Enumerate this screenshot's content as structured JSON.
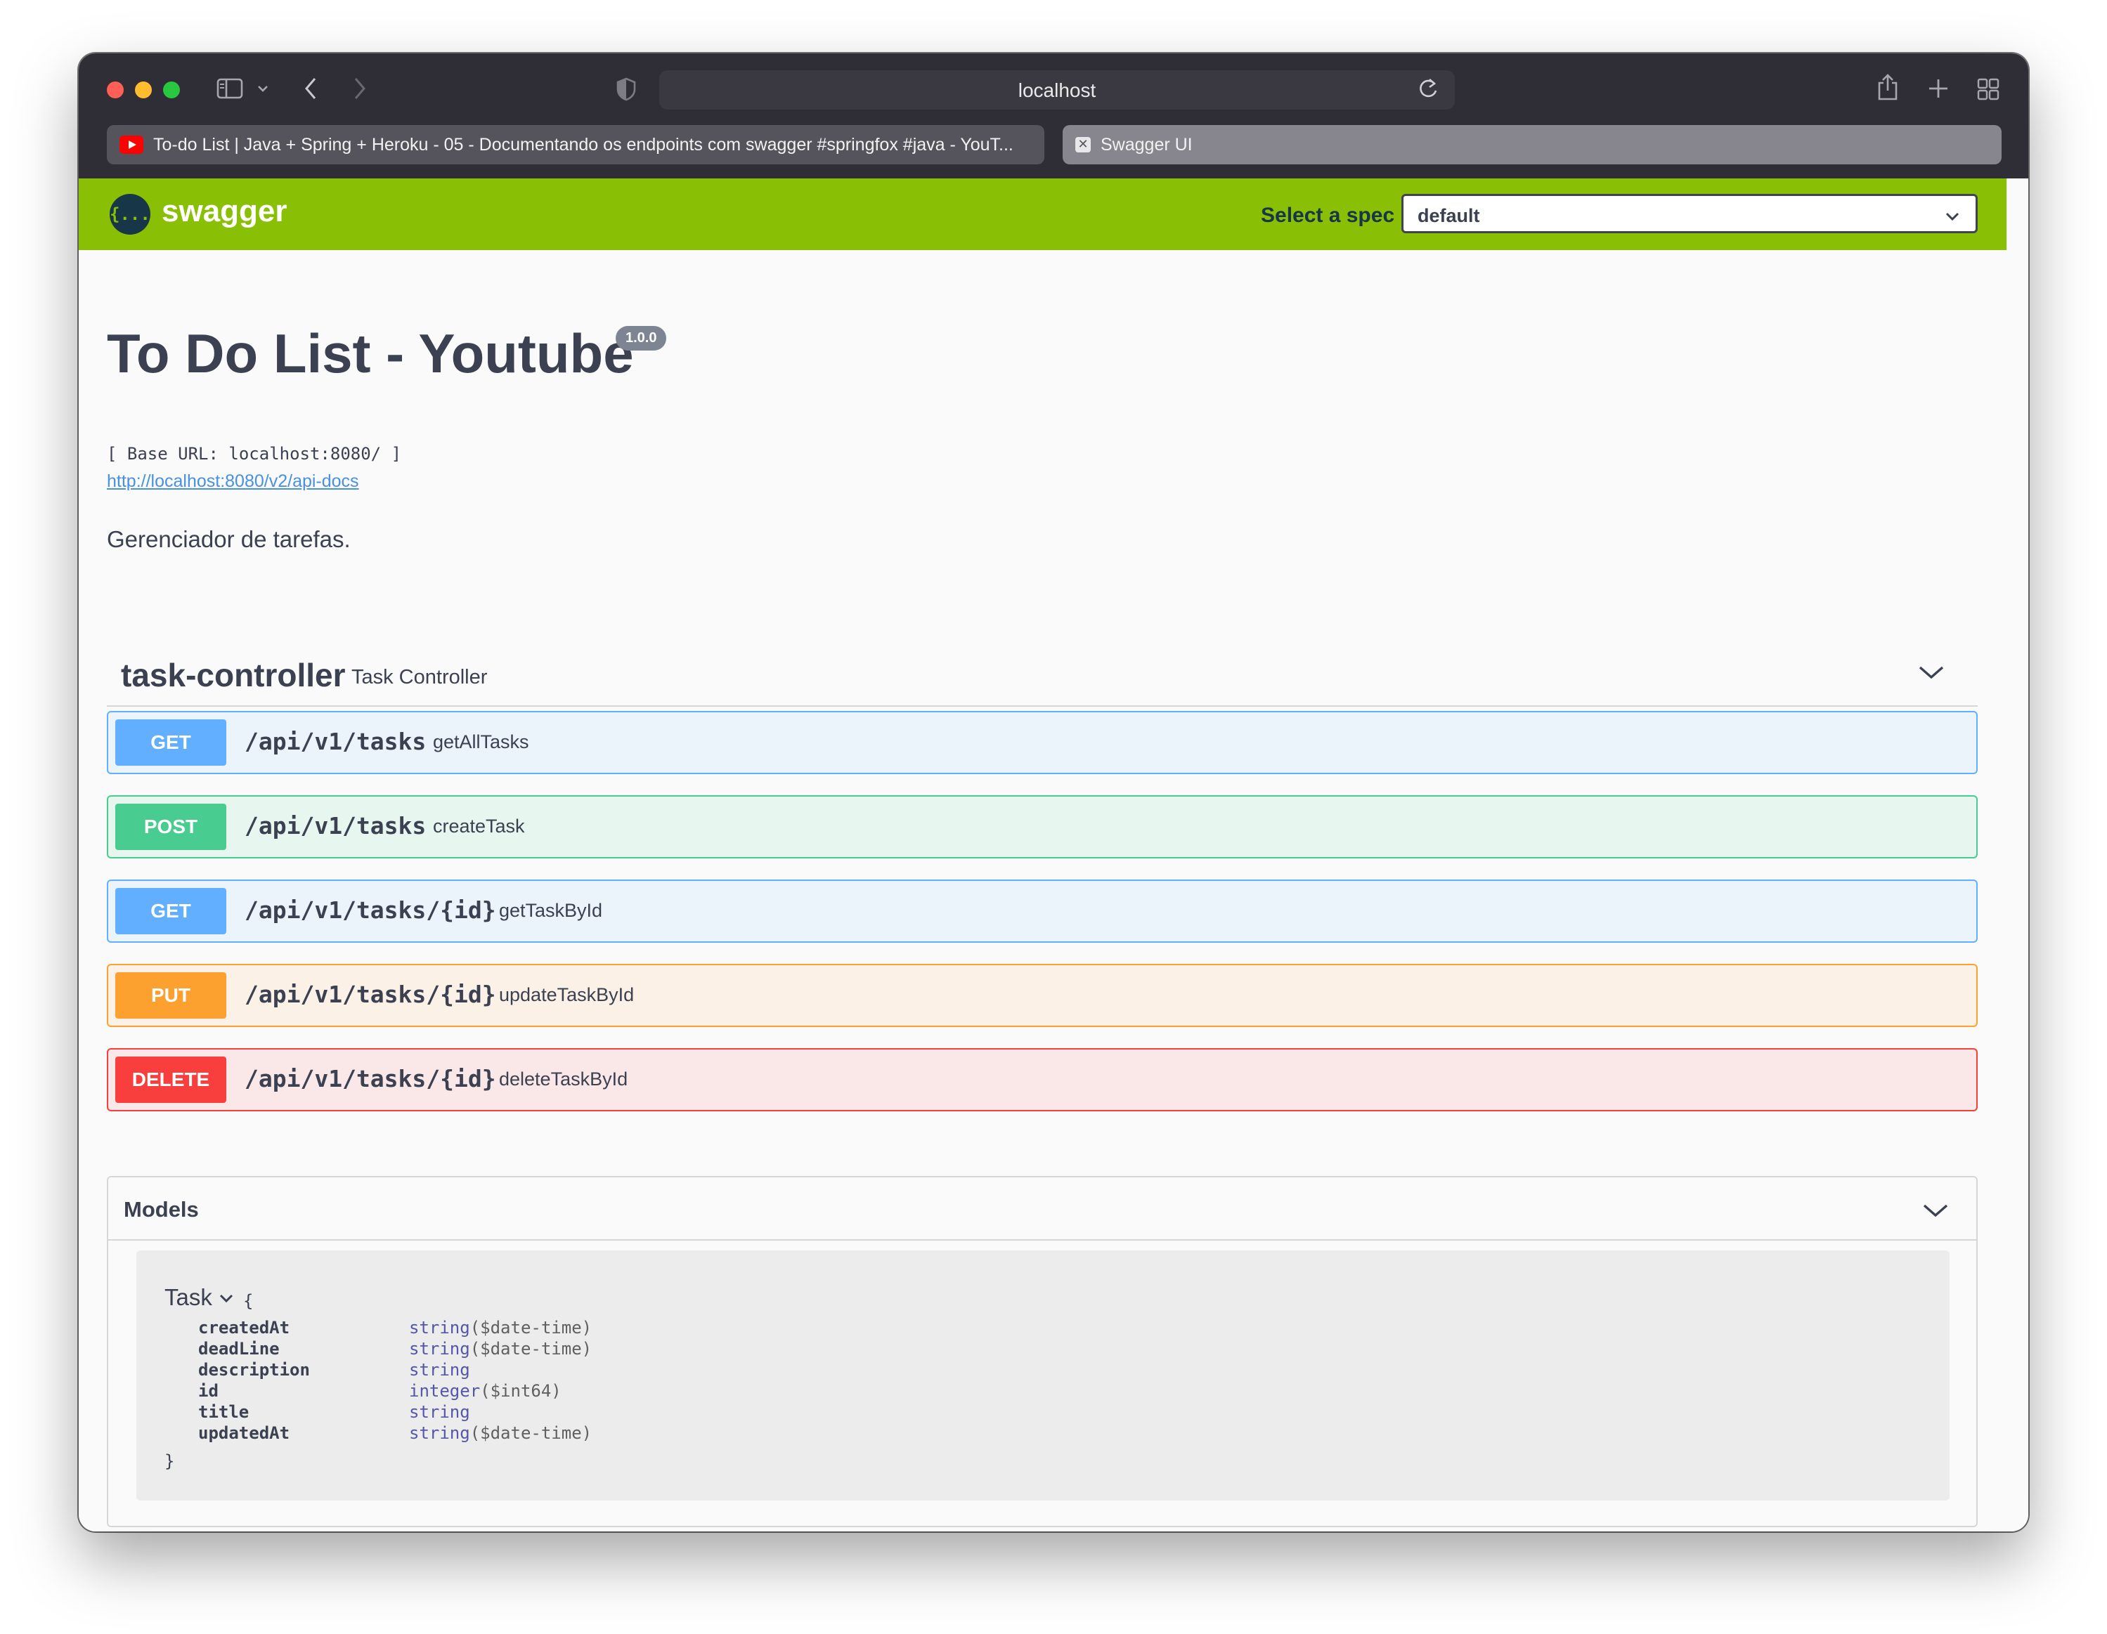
{
  "browser": {
    "url": "localhost",
    "tabs": [
      {
        "title": "To-do List | Java + Spring + Heroku - 05 - Documentando os endpoints com swagger #springfox #java - YouT..."
      },
      {
        "title": "Swagger UI"
      }
    ]
  },
  "topbar": {
    "logo_text": "swagger",
    "logo_glyph": "{...}",
    "spec_label": "Select a spec",
    "spec_value": "default",
    "bar_color": "#89bf04"
  },
  "info": {
    "title": "To Do List - Youtube",
    "version": "1.0.0",
    "base_url": "[ Base URL: localhost:8080/ ]",
    "api_docs_link": "http://localhost:8080/v2/api-docs",
    "description": "Gerenciador de tarefas."
  },
  "tag": {
    "name": "task-controller",
    "description": "Task Controller"
  },
  "operations": [
    {
      "method": "GET",
      "path": "/api/v1/tasks",
      "summary": "getAllTasks",
      "color": "#61affe"
    },
    {
      "method": "POST",
      "path": "/api/v1/tasks",
      "summary": "createTask",
      "color": "#49cc90"
    },
    {
      "method": "GET",
      "path": "/api/v1/tasks/{id}",
      "summary": "getTaskById",
      "color": "#61affe"
    },
    {
      "method": "PUT",
      "path": "/api/v1/tasks/{id}",
      "summary": "updateTaskById",
      "color": "#fca130"
    },
    {
      "method": "DELETE",
      "path": "/api/v1/tasks/{id}",
      "summary": "deleteTaskById",
      "color": "#f93e3e"
    }
  ],
  "models": {
    "title": "Models",
    "model": {
      "name": "Task",
      "open_brace": "{",
      "close_brace": "}",
      "properties": [
        {
          "name": "createdAt",
          "type": "string",
          "format": "($date-time)"
        },
        {
          "name": "deadLine",
          "type": "string",
          "format": "($date-time)"
        },
        {
          "name": "description",
          "type": "string",
          "format": ""
        },
        {
          "name": "id",
          "type": "integer",
          "format": "($int64)"
        },
        {
          "name": "title",
          "type": "string",
          "format": ""
        },
        {
          "name": "updatedAt",
          "type": "string",
          "format": "($date-time)"
        }
      ]
    }
  }
}
